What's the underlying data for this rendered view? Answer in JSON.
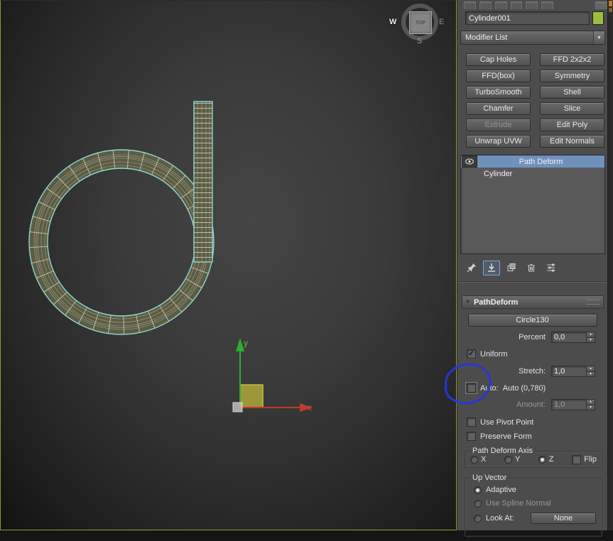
{
  "icons": {
    "check": "✓",
    "dropdown_arrow": "▼",
    "rollout_arrow": "▼",
    "spin_up": "▲",
    "spin_down": "▼"
  },
  "colors": {
    "object_color": "#9bbf3b",
    "stack_selection": "#7191bd",
    "annotation": "#2636d6"
  },
  "viewport": {
    "viewcube": {
      "top_label": "TOP",
      "west": "W",
      "east": "E",
      "south": "S"
    },
    "axis_x_label": "x",
    "axis_y_label": "y"
  },
  "panel": {
    "object_name": "Cylinder001",
    "modifier_list_label": "Modifier List",
    "modifier_buttons": [
      "Cap Holes",
      "FFD 2x2x2",
      "FFD(box)",
      "Symmetry",
      "TurboSmooth",
      "Shell",
      "Chamfer",
      "Slice",
      "Extrude",
      "Edit Poly",
      "Unwrap UVW",
      "Edit Normals"
    ],
    "stack_items": [
      "Path Deform",
      "Cylinder"
    ],
    "pathdeform": {
      "title": "PathDeform",
      "path_button": "Circle130",
      "percent_label": "Percent",
      "percent_value": "0,0",
      "uniform_label": "Uniform",
      "stretch_label": "Stretch:",
      "stretch_value": "1,0",
      "auto_label": "Auto:",
      "auto_readout": "Auto (0,780)",
      "amount_label": "Amount:",
      "amount_value": "1,0",
      "use_pivot_label": "Use Pivot Point",
      "preserve_form_label": "Preserve Form",
      "axis_group_label": "Path Deform Axis",
      "axis_x": "X",
      "axis_y": "Y",
      "axis_z": "Z",
      "flip_label": "Flip",
      "up_vector_label": "Up Vector",
      "adaptive_label": "Adaptive",
      "spline_normal_label": "Use Spline Normal",
      "look_at_label": "Look At:",
      "none_button": "None"
    }
  }
}
